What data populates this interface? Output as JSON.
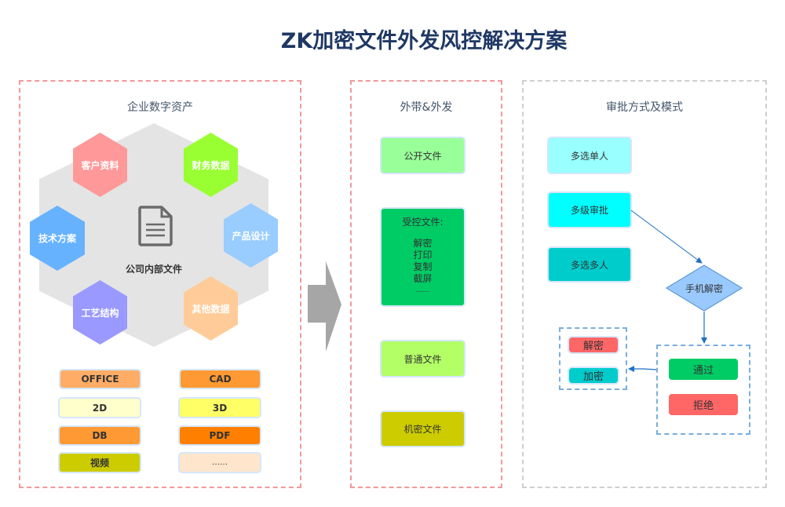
{
  "title": "ZK加密文件外发风控解决方案",
  "assets_panel": {
    "title": "企业数字资产",
    "center_label": "公司内部文件",
    "center_icon": "document-icon",
    "hexagons": [
      {
        "label": "客户资料",
        "color": "#ff9999"
      },
      {
        "label": "财务数据",
        "color": "#99ff33"
      },
      {
        "label": "技术方案",
        "color": "#66b2ff"
      },
      {
        "label": "产品设计",
        "color": "#99ccff"
      },
      {
        "label": "工艺结构",
        "color": "#9999ff"
      },
      {
        "label": "其他数据",
        "color": "#ffcc99"
      }
    ],
    "formats": [
      {
        "label": "OFFICE",
        "color": "#ffad66"
      },
      {
        "label": "CAD",
        "color": "#ff9933"
      },
      {
        "label": "2D",
        "color": "#ffffcc"
      },
      {
        "label": "3D",
        "color": "#ffff66"
      },
      {
        "label": "DB",
        "color": "#ff9933"
      },
      {
        "label": "PDF",
        "color": "#ff8000"
      },
      {
        "label": "视频",
        "color": "#cccc00"
      },
      {
        "label": "……",
        "color": "#ffe5cc"
      }
    ]
  },
  "flow_arrow": {
    "icon": "right-arrow-icon",
    "color": "#a6a6a6"
  },
  "outgoing_panel": {
    "title": "外带&外发",
    "items": [
      {
        "label": "公开文件",
        "color": "#99ff99"
      },
      {
        "label": "受控文件:",
        "color": "#00cc66",
        "sub": [
          "解密",
          "打印",
          "复制",
          "截屏",
          "……"
        ]
      },
      {
        "label": "普通文件",
        "color": "#b3ff66"
      },
      {
        "label": "机密文件",
        "color": "#cccc00"
      }
    ]
  },
  "approval_panel": {
    "title": "审批方式及模式",
    "modes": [
      {
        "label": "多选单人",
        "color": "#99ffff"
      },
      {
        "label": "多级审批",
        "color": "#00ffff"
      },
      {
        "label": "多选多人",
        "color": "#00cccc"
      }
    ],
    "decision": {
      "label": "手机解密",
      "color": "#99c9ff"
    },
    "results": [
      {
        "label": "通过",
        "color": "#00cc66"
      },
      {
        "label": "拒绝",
        "color": "#ff6666"
      }
    ],
    "actions": [
      {
        "label": "解密",
        "color": "#ff6666"
      },
      {
        "label": "加密",
        "color": "#00cccc"
      }
    ],
    "connector_color": "#1f6fc5"
  }
}
